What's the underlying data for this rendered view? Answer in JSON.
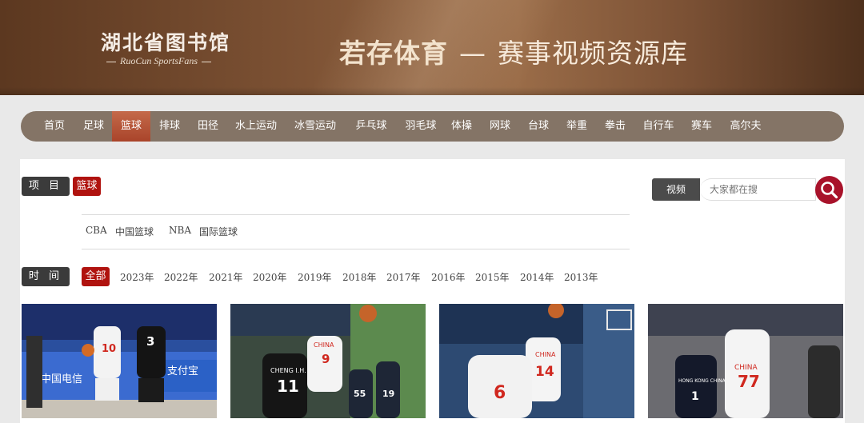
{
  "banner": {
    "library_name": "湖北省图书馆",
    "library_sub": "RuoCun SportsFans",
    "title_strong": "若存体育",
    "title_sep": "—",
    "title_rest": "赛事视频资源库"
  },
  "nav": {
    "items": [
      "首页",
      "足球",
      "篮球",
      "排球",
      "田径",
      "水上运动",
      "冰雪运动",
      "乒乓球",
      "羽毛球",
      "体操",
      "网球",
      "台球",
      "举重",
      "拳击",
      "自行车",
      "赛车",
      "高尔夫"
    ],
    "active": "篮球"
  },
  "filters": {
    "project_label": "项 目",
    "project_value": "篮球",
    "subcategories": [
      "CBA",
      "中国篮球",
      "NBA",
      "国际篮球"
    ],
    "time_label": "时 间",
    "all_label": "全部",
    "years": [
      "2023年",
      "2022年",
      "2021年",
      "2020年",
      "2019年",
      "2018年",
      "2017年",
      "2016年",
      "2015年",
      "2014年",
      "2013年"
    ]
  },
  "search": {
    "label": "视频",
    "placeholder": "大家都在搜"
  },
  "colors": {
    "banner": "#7d5234",
    "nav": "#847466",
    "active": "#b0130f",
    "search_button": "#a8122a"
  },
  "thumbnails": [
    {
      "jersey_a": "10",
      "jersey_b": "3",
      "sign": "中国电信",
      "sign2": "支付宝"
    },
    {
      "jersey_a": "9",
      "jersey_b": "11",
      "jersey_c": "55",
      "jersey_d": "19",
      "team": "CHINA",
      "name": "CHENG I.H."
    },
    {
      "jersey_a": "14",
      "jersey_b": "6",
      "team": "CHINA"
    },
    {
      "jersey_a": "77",
      "jersey_b": "1",
      "team": "CHINA",
      "team_b": "HONG KONG CHINA"
    }
  ]
}
